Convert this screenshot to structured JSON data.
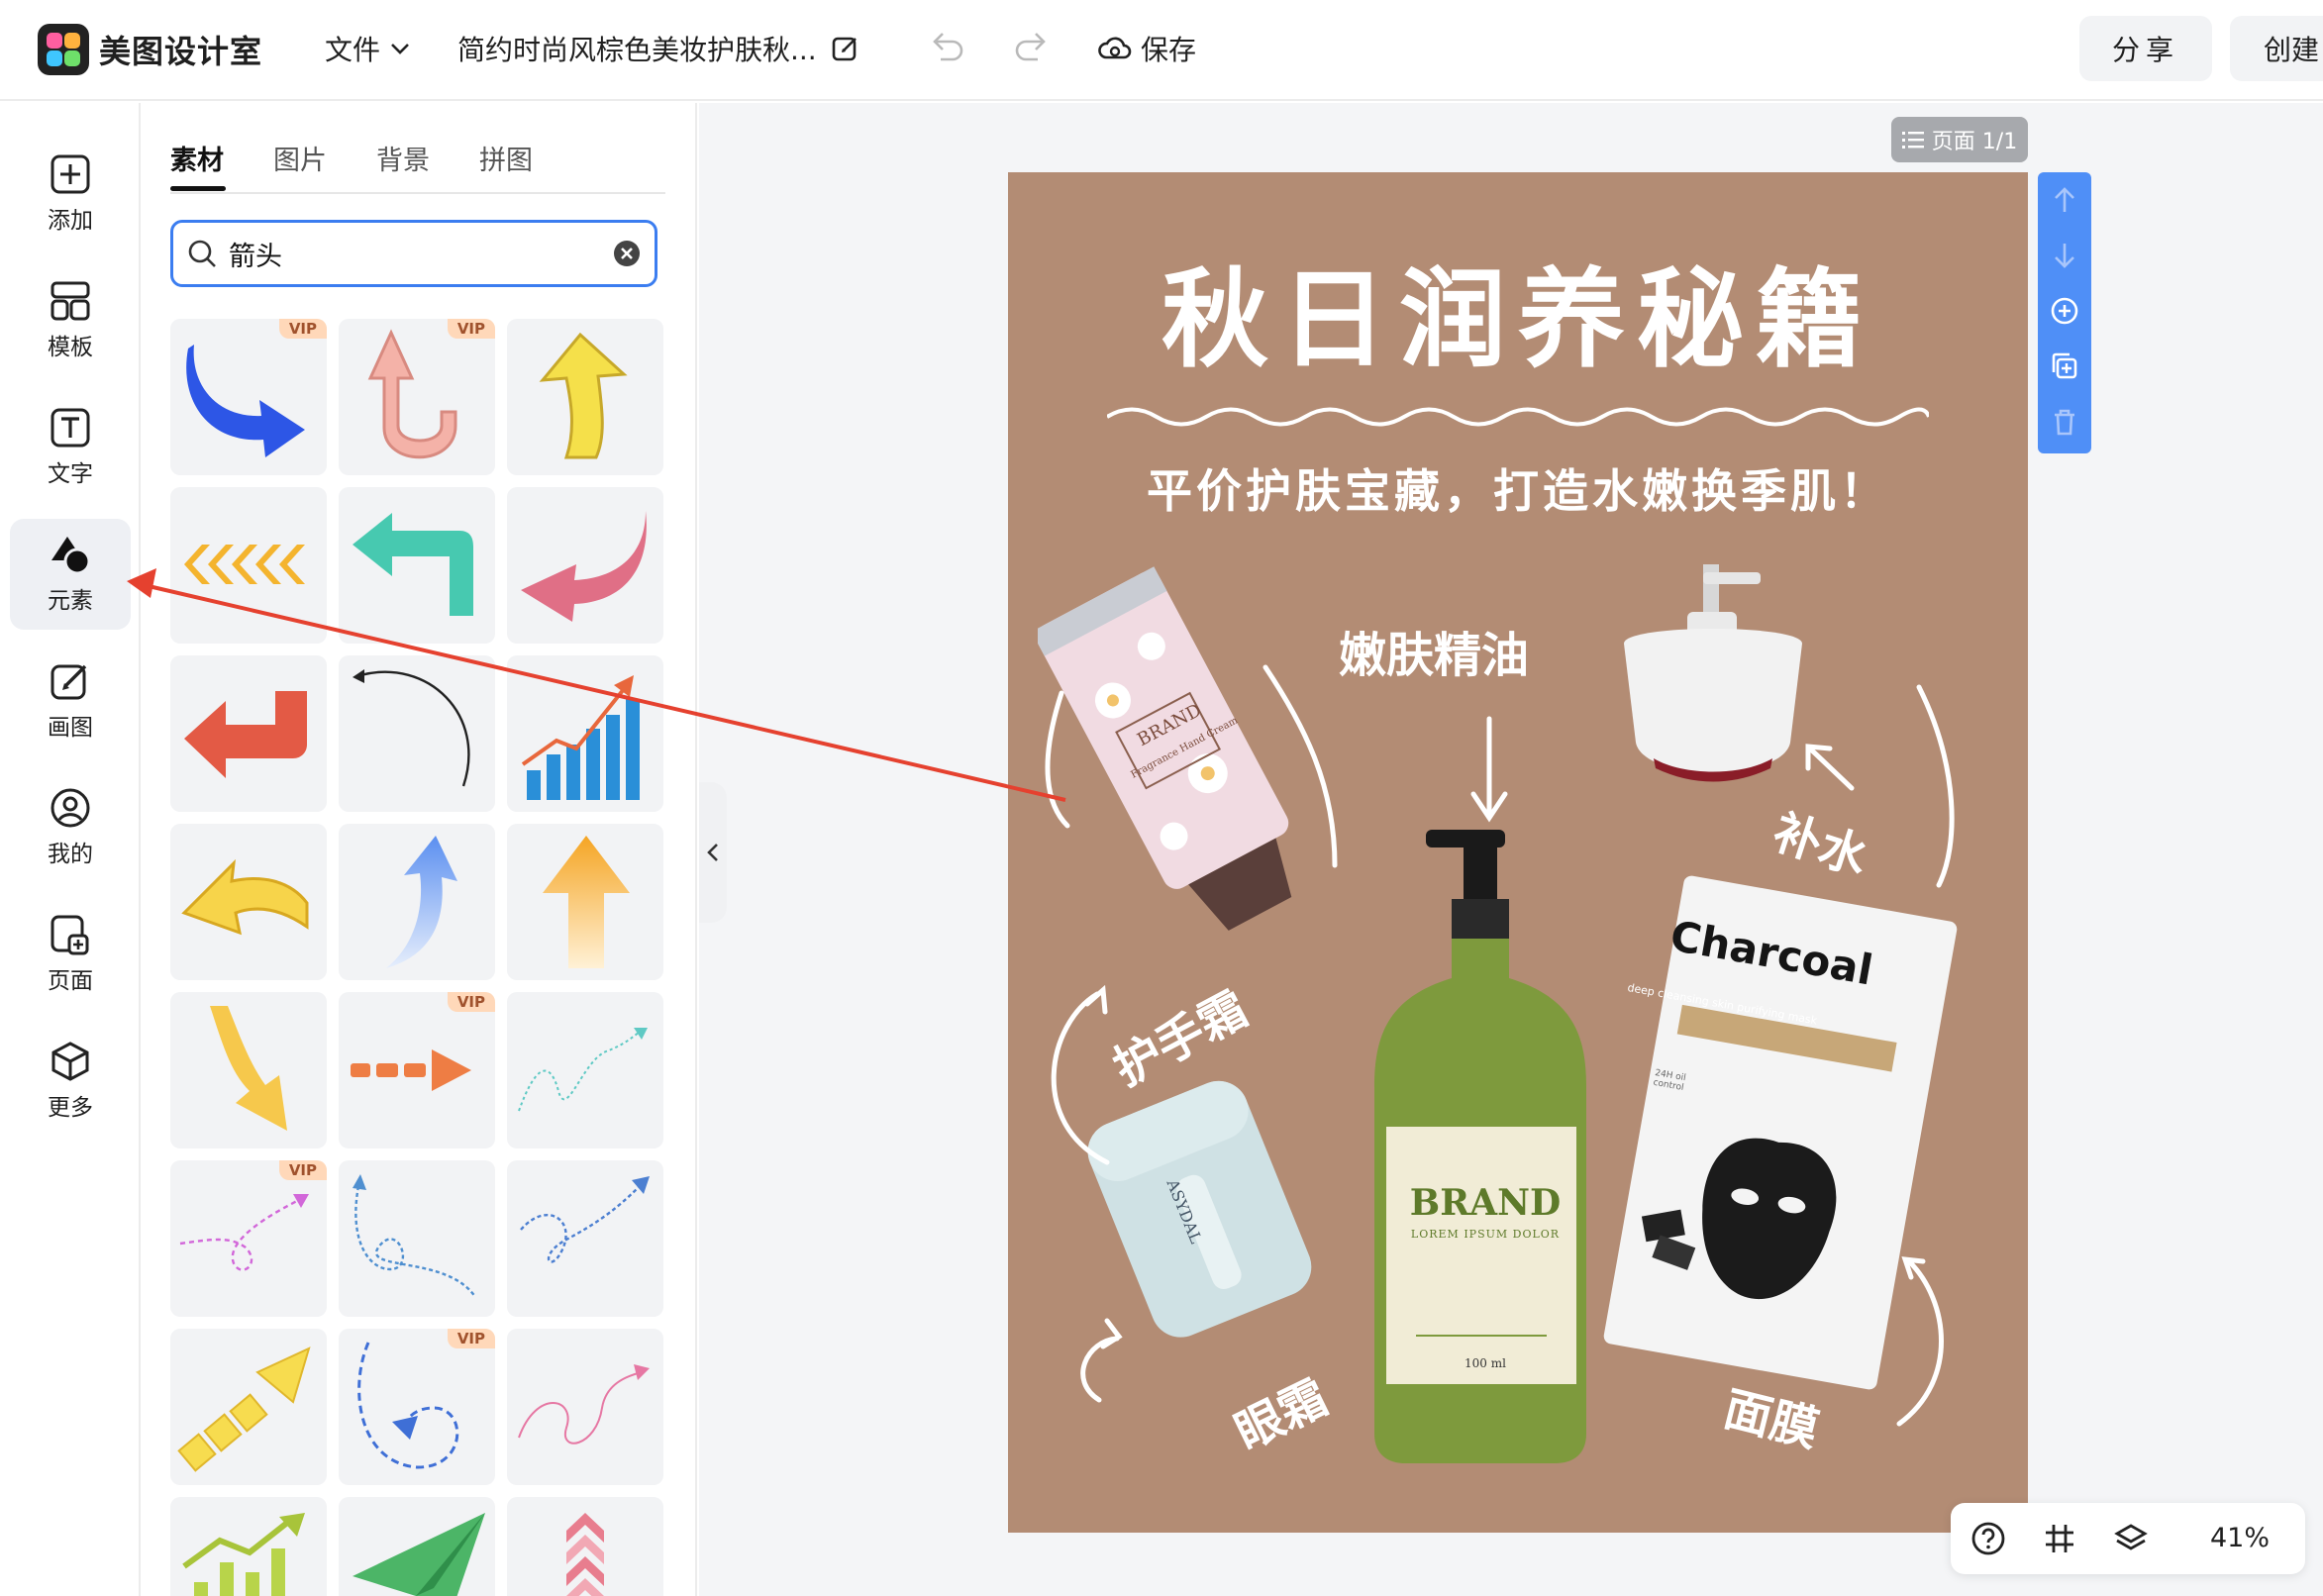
{
  "app": {
    "name": "美图设计室"
  },
  "header": {
    "file_menu": "文件",
    "doc_title": "简约时尚风棕色美妆护肤秋...",
    "save_label": "保存",
    "share_label": "分享",
    "create_label": "创建"
  },
  "rail": {
    "items": [
      {
        "label": "添加",
        "icon": "plus-square-icon"
      },
      {
        "label": "模板",
        "icon": "template-icon"
      },
      {
        "label": "文字",
        "icon": "text-icon"
      },
      {
        "label": "元素",
        "icon": "shapes-icon",
        "active": true
      },
      {
        "label": "画图",
        "icon": "draw-icon"
      },
      {
        "label": "我的",
        "icon": "user-icon"
      },
      {
        "label": "页面",
        "icon": "add-page-icon"
      },
      {
        "label": "更多",
        "icon": "cube-icon"
      }
    ]
  },
  "panel": {
    "tabs": [
      "素材",
      "图片",
      "背景",
      "拼图"
    ],
    "active_tab": "素材",
    "search_value": "箭头",
    "vip_label": "VIP",
    "tiles": [
      {
        "name": "blue-brush-curved-arrow",
        "vip": true
      },
      {
        "name": "pink-u-turn-arrow",
        "vip": true
      },
      {
        "name": "yellow-up-arrow",
        "vip": false
      },
      {
        "name": "orange-chevrons-arrow",
        "vip": false
      },
      {
        "name": "teal-turn-left-arrow",
        "vip": false
      },
      {
        "name": "pink-curved-left-arrow",
        "vip": false
      },
      {
        "name": "red-return-arrow",
        "vip": false
      },
      {
        "name": "thin-curved-arrow",
        "vip": false
      },
      {
        "name": "growth-chart-arrow",
        "vip": false
      },
      {
        "name": "yellow-bent-left-arrow",
        "vip": false
      },
      {
        "name": "blue-gradient-up-arrow",
        "vip": false
      },
      {
        "name": "orange-gradient-up-arrow",
        "vip": false
      },
      {
        "name": "yellow-down-arrow",
        "vip": false
      },
      {
        "name": "orange-dashed-right-arrow",
        "vip": true
      },
      {
        "name": "teal-squiggle-arrow",
        "vip": false
      },
      {
        "name": "pink-dotted-loop-arrow",
        "vip": true
      },
      {
        "name": "blue-dotted-swirl-arrow",
        "vip": false
      },
      {
        "name": "blue-dotted-loop-arrow",
        "vip": false
      },
      {
        "name": "yellow-diagonal-arrow",
        "vip": false
      },
      {
        "name": "blue-dashed-return-arrow",
        "vip": true
      },
      {
        "name": "pink-squiggle-arrow",
        "vip": false
      },
      {
        "name": "green-bar-chart-arrow",
        "vip": false
      },
      {
        "name": "green-paper-plane-arrow",
        "vip": false
      },
      {
        "name": "pink-chevron-stack-arrow",
        "vip": false
      }
    ]
  },
  "canvas": {
    "page_indicator": "页面 1/1",
    "zoom": "41%",
    "poster": {
      "title": "秋日润养秘籍",
      "subtitle": "平价护肤宝藏，打造水嫩换季肌！",
      "labels": {
        "oil": "嫩肤精油",
        "hydrate": "补水",
        "hand_cream": "护手霜",
        "eye_cream": "眼霜",
        "mask": "面膜"
      },
      "tube_brand": "BRAND",
      "tube_sub": "Fragrance Hand Cream",
      "bottle_brand": "BRAND",
      "bottle_sub": "LOREM IPSUM DOLOR",
      "bottle_volume": "100 ml",
      "mask_brand": "Charcoal",
      "mask_sub": "deep cleansing skin purifying mask",
      "mask_badge": "24H oil control",
      "jar_brand": "ASYDAL",
      "background_color": "#b38c74"
    }
  },
  "colors": {
    "accent": "#3b7df0",
    "annotation_arrow": "#e5412f",
    "vip_badge": "#ffd8b9"
  }
}
